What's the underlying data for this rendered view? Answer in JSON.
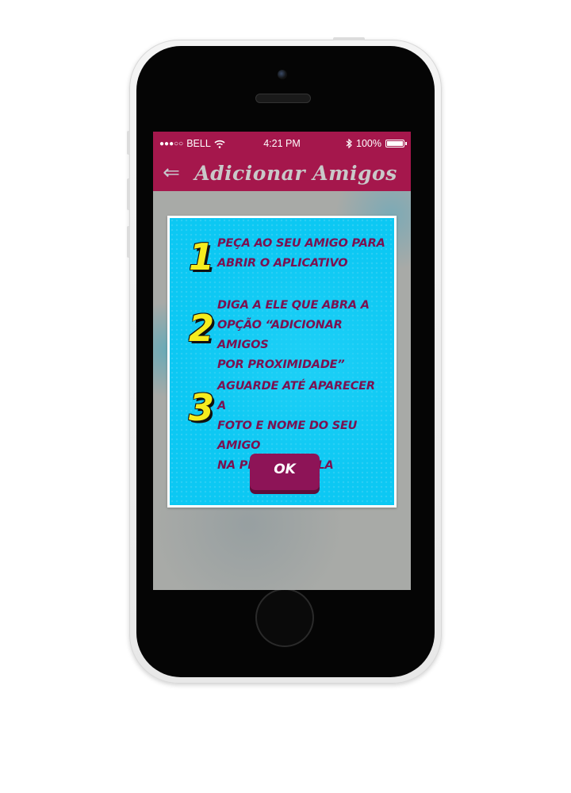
{
  "status_bar": {
    "signal_dots": "●●●○○",
    "carrier": "BELL",
    "wifi_icon": "wifi-icon",
    "time": "4:21 PM",
    "bluetooth_icon": "bluetooth-icon",
    "battery_percent": "100%",
    "battery_level": 1.0
  },
  "nav": {
    "back_icon": "back-arrow-icon",
    "title": "Adicionar Amigos",
    "bar_color": "#a5174c"
  },
  "modal": {
    "background_color": "#1ed0f7",
    "steps": [
      {
        "number": "1",
        "text": "PEÇA AO SEU AMIGO PARA\nABRIR O APLICATIVO"
      },
      {
        "number": "2",
        "text": "DIGA A ELE QUE ABRA A\nOPÇÃO “ADICIONAR AMIGOS\nPOR PROXIMIDADE”"
      },
      {
        "number": "3",
        "text": "AGUARDE ATÉ APARECER A\nFOTO E NOME DO SEU AMIGO\nNA PRÓXIMA TELA"
      }
    ],
    "ok_label": "OK"
  }
}
